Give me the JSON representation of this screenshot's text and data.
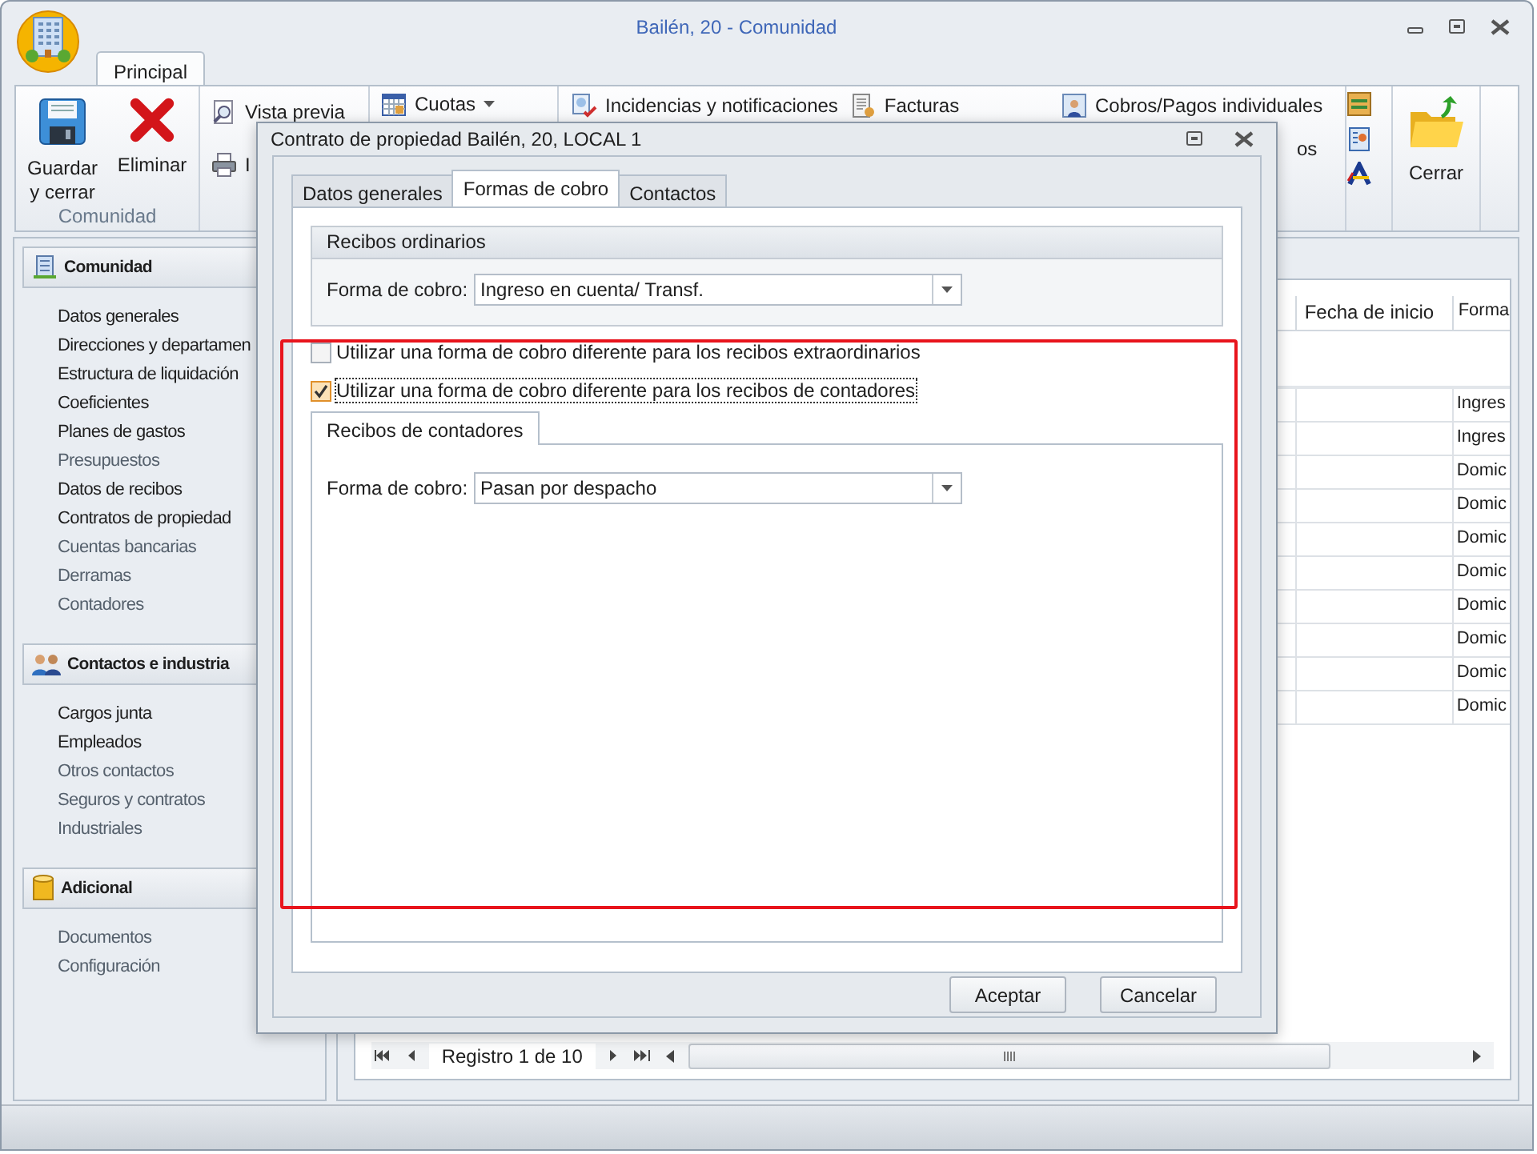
{
  "window": {
    "title": "Bailén, 20 - Comunidad"
  },
  "ribbon": {
    "tabs": [
      {
        "label": "Principal",
        "selected": true
      }
    ],
    "large_buttons": [
      {
        "label": "Guardar y cerrar"
      },
      {
        "label": "Eliminar"
      }
    ],
    "group_label": "Comunidad",
    "small_buttons": [
      {
        "label": "Vista previa"
      },
      {
        "label": "I"
      }
    ],
    "dropdown": {
      "label": "Cuotas"
    },
    "links": [
      {
        "label": "Incidencias y notificaciones"
      },
      {
        "label": "Facturas"
      },
      {
        "label": "Cobros/Pagos individuales"
      }
    ],
    "partial_label": "os",
    "close_button": {
      "label": "Cerrar"
    }
  },
  "sidebar": [
    {
      "title": "Comunidad",
      "items": [
        {
          "label": "Datos generales",
          "active": true
        },
        {
          "label": "Direcciones y departamen",
          "active": true
        },
        {
          "label": "Estructura de liquidación",
          "active": true
        },
        {
          "label": "Coeficientes",
          "active": true
        },
        {
          "label": "Planes de gastos",
          "active": true
        },
        {
          "label": "Presupuestos",
          "active": false
        },
        {
          "label": "Datos de recibos",
          "active": true
        },
        {
          "label": "Contratos de propiedad",
          "active": true
        },
        {
          "label": "Cuentas bancarias",
          "active": false
        },
        {
          "label": "Derramas",
          "active": false
        },
        {
          "label": "Contadores",
          "active": false
        }
      ]
    },
    {
      "title": "Contactos e industria",
      "items": [
        {
          "label": "Cargos junta",
          "active": true
        },
        {
          "label": "Empleados",
          "active": true
        },
        {
          "label": "Otros contactos",
          "active": false
        },
        {
          "label": "Seguros y contratos",
          "active": false
        },
        {
          "label": "Industriales",
          "active": false
        }
      ]
    },
    {
      "title": "Adicional",
      "items": [
        {
          "label": "Documentos",
          "active": false
        },
        {
          "label": "Configuración",
          "active": false
        }
      ]
    }
  ],
  "grid": {
    "columns": [
      "Fecha de inicio",
      "Forma"
    ],
    "rows": [
      {
        "forma": "Ingres"
      },
      {
        "forma": "Ingres"
      },
      {
        "forma": "Domic"
      },
      {
        "forma": "Domic"
      },
      {
        "forma": "Domic"
      },
      {
        "forma": "Domic"
      },
      {
        "forma": "Domic"
      },
      {
        "forma": "Domic"
      },
      {
        "forma": "Domic"
      },
      {
        "forma": "Domic"
      }
    ],
    "navigator": "Registro 1 de 10"
  },
  "dialog": {
    "title": "Contrato de propiedad Bailén, 20, LOCAL 1",
    "tabs": [
      {
        "label": "Datos generales",
        "selected": false
      },
      {
        "label": "Formas de cobro",
        "selected": true
      },
      {
        "label": "Contactos",
        "selected": false
      }
    ],
    "ordinary": {
      "title": "Recibos ordinarios",
      "label": "Forma de cobro:",
      "value": "Ingreso en cuenta/ Transf."
    },
    "checkboxes": [
      {
        "label": "Utilizar una forma de cobro diferente para los recibos extraordinarios",
        "checked": false,
        "focused": false
      },
      {
        "label": "Utilizar una forma de cobro diferente para los recibos de contadores",
        "checked": true,
        "focused": true
      }
    ],
    "meter_tab": {
      "title": "Recibos de contadores",
      "label": "Forma de cobro:",
      "value": "Pasan por despacho"
    },
    "buttons": [
      "Aceptar",
      "Cancelar"
    ]
  }
}
